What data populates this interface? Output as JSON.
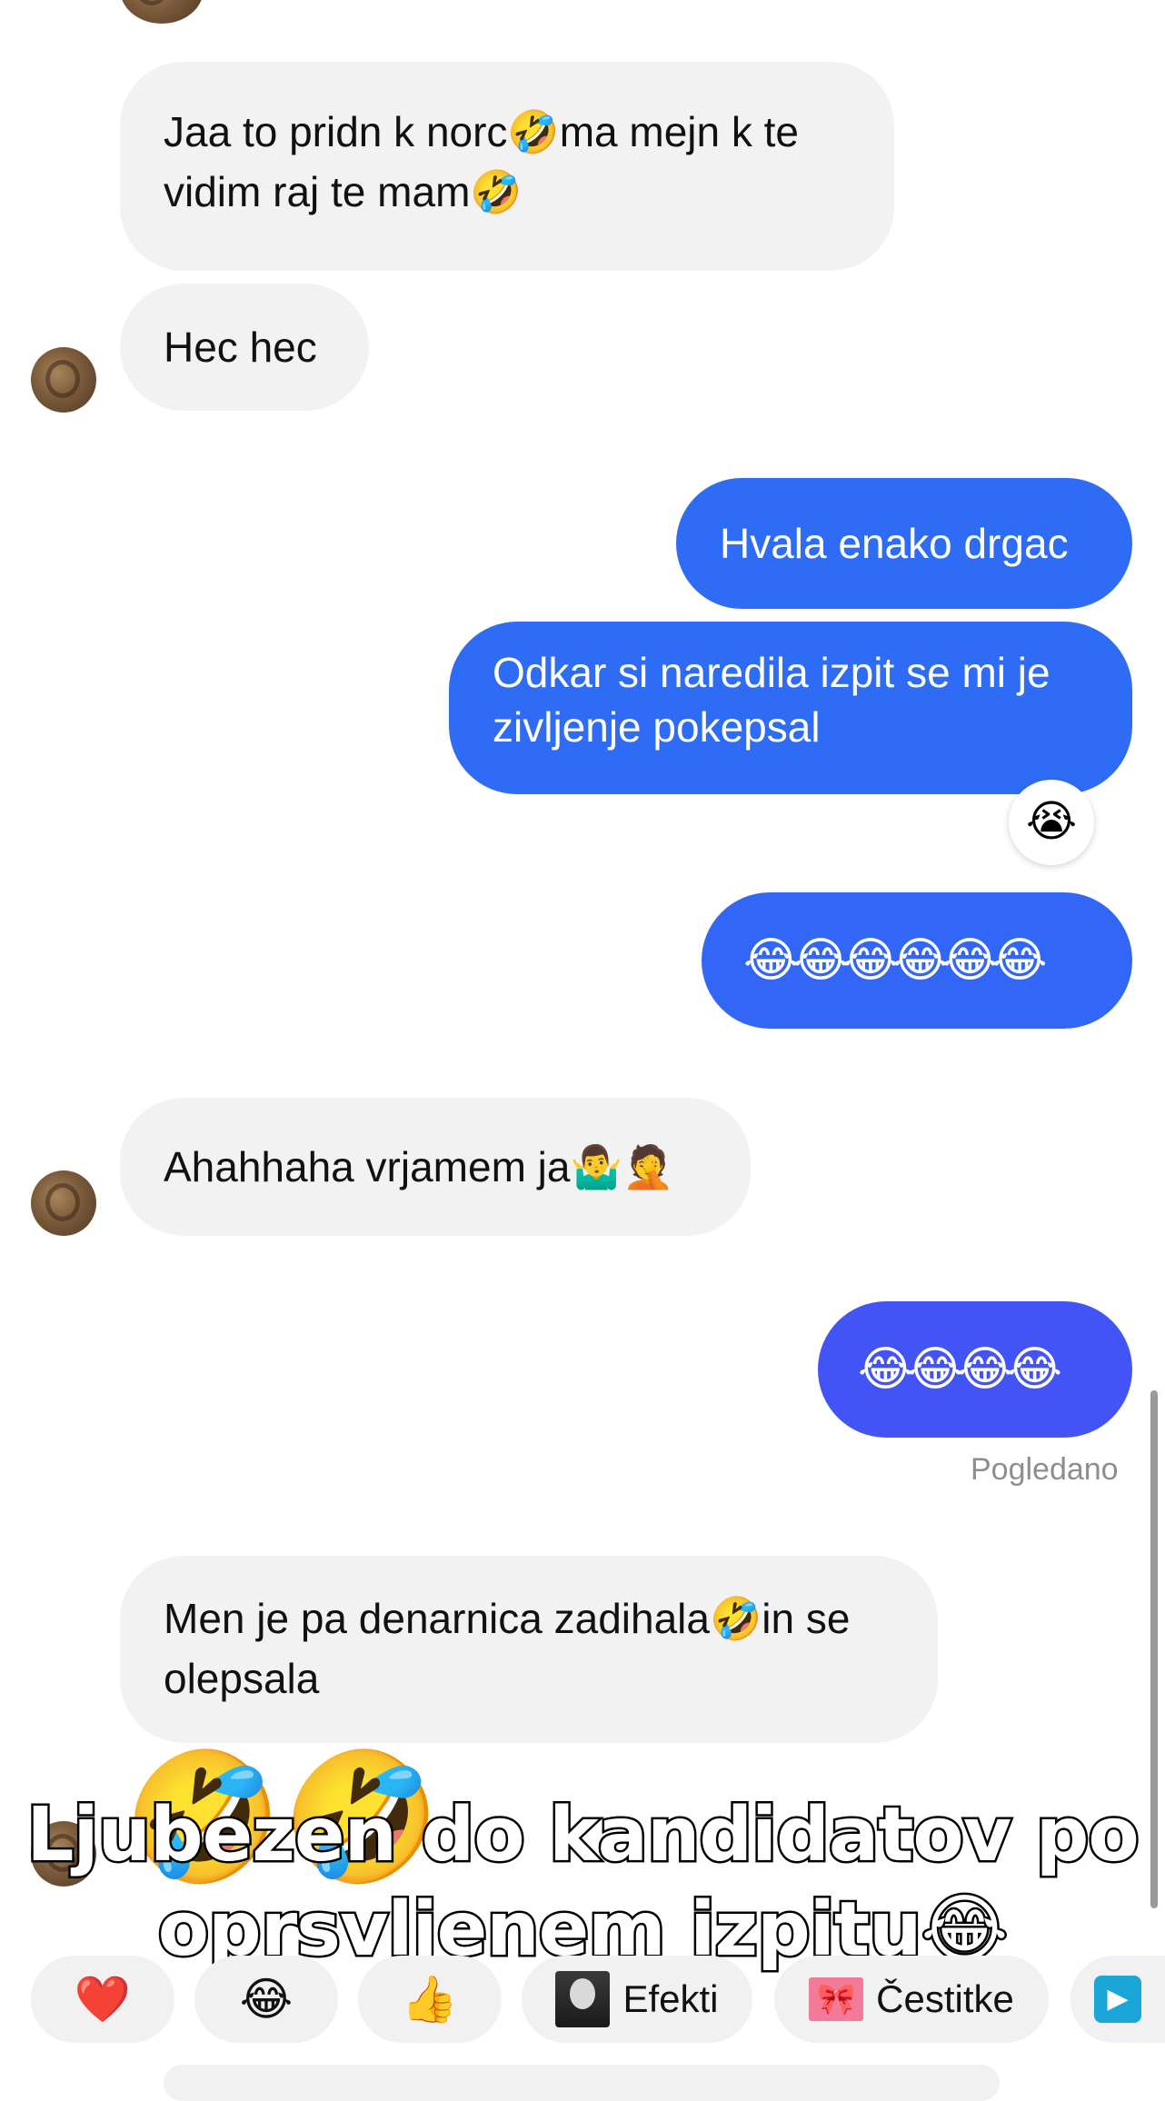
{
  "colors": {
    "outgoing_blue": "#2f6cf6",
    "outgoing_indigo": "#4254f5",
    "incoming_bg": "#f2f2f2",
    "seen_text": "#8e8e8e"
  },
  "messages": [
    {
      "from": "them",
      "text": "Jaa to pridn k norc🤣ma mejn k te\nvidim raj te mam🤣"
    },
    {
      "from": "them",
      "text": "Hec hec"
    },
    {
      "from": "me",
      "text": "Hvala enako drgac"
    },
    {
      "from": "me",
      "text": "Odkar si naredila izpit se mi je\nzivljenje pokepsal"
    },
    {
      "from": "me",
      "text": "😂😂😂😂😂😂"
    },
    {
      "from": "them",
      "text": "Ahahhaha vrjamem ja🤷‍♂️🤦"
    },
    {
      "from": "me",
      "text": "😂😂😂😂"
    },
    {
      "from": "them",
      "text": "Men je pa denarnica zadihala🤣in se\nolepsala"
    },
    {
      "from": "them",
      "text": "🤣🤣"
    }
  ],
  "reaction": {
    "emoji": "😭",
    "icon": "loudly-crying-face-icon"
  },
  "seen_label": "Pogledano",
  "caption": {
    "line1": "Ljubezen do kandidatov po",
    "line2": "oprsvljenem izpitu😂"
  },
  "quick_replies": [
    {
      "icon": "❤️",
      "icon_name": "heart-icon"
    },
    {
      "icon": "😂",
      "icon_name": "laughing-face-icon"
    },
    {
      "icon": "👍",
      "icon_name": "thumbs-up-icon"
    },
    {
      "label": "Efekti",
      "icon_name": "effects-thumbnail-icon"
    },
    {
      "label": "Čestitke",
      "icon_name": "gift-bow-icon"
    },
    {
      "icon": "▶",
      "icon_name": "play-icon"
    }
  ]
}
